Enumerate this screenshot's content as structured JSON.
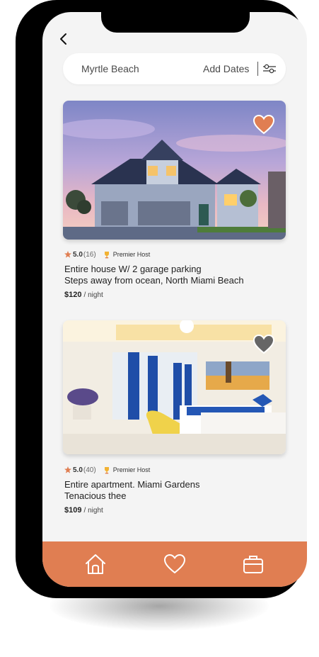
{
  "search": {
    "location": "Myrtle Beach",
    "dates": "Add Dates"
  },
  "icons": {
    "back": "chevron-left-icon",
    "filter": "sliders-icon",
    "favorite": "heart-icon",
    "rating": "star-icon",
    "host": "trophy-icon",
    "home": "home-icon",
    "saved": "heart-outline-icon",
    "trips": "briefcase-icon"
  },
  "colors": {
    "accent": "#e07e52",
    "favorite_active": "#e07e52",
    "favorite_inactive": "#666666"
  },
  "listings": [
    {
      "rating": "5.0",
      "reviews": "(16)",
      "host_badge": "Premier Host",
      "title_line1": "Entire house W/ 2 garage parking",
      "title_line2": "Steps away from ocean, North Miami Beach",
      "price": "$120",
      "price_unit": "/ night"
    },
    {
      "rating": "5.0",
      "reviews": "(40)",
      "host_badge": "Premier Host",
      "title_line1": "Entire apartment. Miami Gardens",
      "title_line2": "Tenacious thee",
      "price": "$109",
      "price_unit": "/ night"
    }
  ]
}
